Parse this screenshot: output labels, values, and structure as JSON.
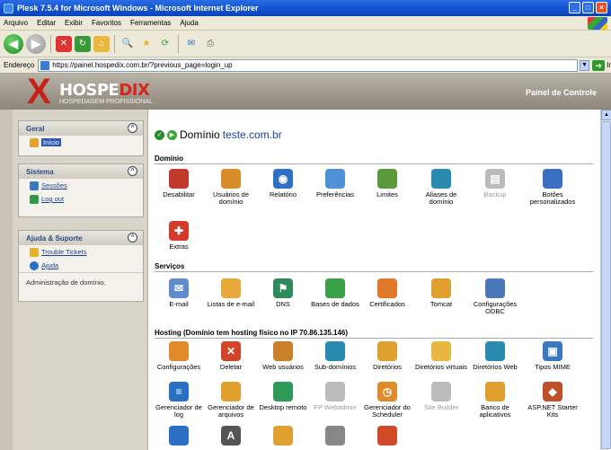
{
  "window": {
    "title": "Plesk 7.5.4 for Microsoft Windows - Microsoft Internet Explorer"
  },
  "menu": [
    "Arquivo",
    "Editar",
    "Exibir",
    "Favoritos",
    "Ferramentas",
    "Ajuda"
  ],
  "address": {
    "label": "Endereço",
    "url": "https://painel.hospedix.com.br/?previous_page=login_up",
    "go": "Ir"
  },
  "brand": {
    "name_a": "HOSPE",
    "name_b": "DIX",
    "tagline": "HOSPEDAGEM PROFISSIONAL",
    "panel": "Painel de Controle"
  },
  "sidebar": {
    "geral": {
      "title": "Geral",
      "items": [
        "Início"
      ]
    },
    "sistema": {
      "title": "Sistema",
      "items": [
        "Sessões",
        "Log out"
      ]
    },
    "ajuda": {
      "title": "Ajuda & Suporte",
      "items": [
        "Trouble Tickets",
        "Ajuda"
      ],
      "note": "Administração de domínio."
    }
  },
  "domain": {
    "label": "Domínio",
    "name": "teste.com.br"
  },
  "sections": {
    "dominio": "Domínio",
    "servicos": "Serviços",
    "hosting": "Hosting (Domínio tem hosting físico no IP 70.86.135.146)"
  },
  "tiles": {
    "dominio": [
      {
        "label": "Desabilitar",
        "icon": "disable-icon",
        "color": "#c0392b"
      },
      {
        "label": "Usuários de domínio",
        "icon": "domain-users-icon",
        "color": "#d98c2a"
      },
      {
        "label": "Relatório",
        "icon": "report-icon",
        "color": "#2f6fc4"
      },
      {
        "label": "Preferências",
        "icon": "preferences-icon",
        "color": "#4f91d6"
      },
      {
        "label": "Limites",
        "icon": "limits-icon",
        "color": "#5a9a3a"
      },
      {
        "label": "Aliases de domínio",
        "icon": "domain-aliases-icon",
        "color": "#2a8ab0"
      },
      {
        "label": "Backup",
        "icon": "backup-icon",
        "color": "#bbbbbb",
        "disabled": true
      },
      {
        "label": "Botões personalizados",
        "icon": "custom-buttons-icon",
        "color": "#3a6fc0"
      },
      {
        "label": "Extras",
        "icon": "extras-icon",
        "color": "#d23a2a"
      }
    ],
    "servicos": [
      {
        "label": "E-mail",
        "icon": "email-icon",
        "color": "#5f8ccc"
      },
      {
        "label": "Listas de e-mail",
        "icon": "mailing-lists-icon",
        "color": "#e8a83a"
      },
      {
        "label": "DNS",
        "icon": "dns-icon",
        "color": "#2d8a5a"
      },
      {
        "label": "Bases de dados",
        "icon": "databases-icon",
        "color": "#3aa04a"
      },
      {
        "label": "Certificados",
        "icon": "certificates-icon",
        "color": "#e07a2a"
      },
      {
        "label": "Tomcat",
        "icon": "tomcat-icon",
        "color": "#e0a030"
      },
      {
        "label": "Configurações ODBC",
        "icon": "odbc-icon",
        "color": "#4a78b8"
      }
    ],
    "hosting_row1": [
      {
        "label": "Configurações",
        "icon": "hosting-settings-icon",
        "color": "#e08a2a"
      },
      {
        "label": "Deletar",
        "icon": "delete-icon",
        "color": "#d0452a"
      },
      {
        "label": "Web usuários",
        "icon": "web-users-icon",
        "color": "#c9802a"
      },
      {
        "label": "Sub-domínios",
        "icon": "subdomains-icon",
        "color": "#2a8ab0"
      },
      {
        "label": "Diretórios",
        "icon": "directories-icon",
        "color": "#e0a030"
      },
      {
        "label": "Diretórios virtuais",
        "icon": "virtual-dirs-icon",
        "color": "#e8b840"
      },
      {
        "label": "Diretórios Web",
        "icon": "web-dirs-icon",
        "color": "#2a8ab0"
      },
      {
        "label": "Tipos MIME",
        "icon": "mime-types-icon",
        "color": "#3a78c0"
      }
    ],
    "hosting_row2": [
      {
        "label": "Gerenciador de log",
        "icon": "log-manager-icon",
        "color": "#2a6fc4"
      },
      {
        "label": "Gerenciador de arquivos",
        "icon": "file-manager-icon",
        "color": "#e0a030"
      },
      {
        "label": "Desktop remoto",
        "icon": "remote-desktop-icon",
        "color": "#2d9a5a"
      },
      {
        "label": "FP Webadmin",
        "icon": "fp-webadmin-icon",
        "color": "#bbbbbb",
        "disabled": true
      },
      {
        "label": "Gerenciador do Scheduler",
        "icon": "scheduler-icon",
        "color": "#e08a2a"
      },
      {
        "label": "Site Builder",
        "icon": "site-builder-icon",
        "color": "#bbbbbb",
        "disabled": true
      },
      {
        "label": "Banco de aplicativos",
        "icon": "app-vault-icon",
        "color": "#e0a030"
      },
      {
        "label": "ASP.NET Starter Kits",
        "icon": "aspnet-kits-icon",
        "color": "#c0502a"
      }
    ],
    "hosting_row3": [
      {
        "label": "",
        "icon": "asp-settings-icon",
        "color": "#2a6fc4"
      },
      {
        "label": "",
        "icon": "asp-net-icon",
        "color": "#555555"
      },
      {
        "label": "",
        "icon": "folder-stack-icon",
        "color": "#e0a030"
      },
      {
        "label": "",
        "icon": "globe-icon",
        "color": "#888888"
      },
      {
        "label": "",
        "icon": "app-icon",
        "color": "#d04a2a"
      }
    ]
  }
}
